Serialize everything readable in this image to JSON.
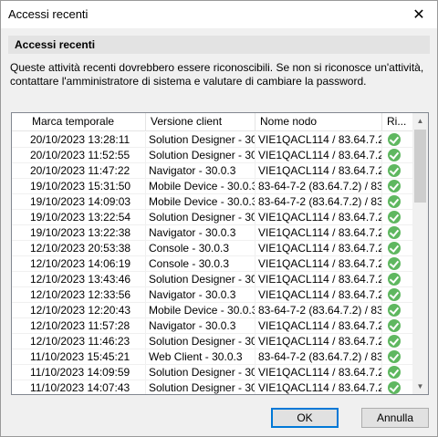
{
  "window": {
    "title": "Accessi recenti",
    "close_glyph": "✕"
  },
  "section": {
    "title": "Accessi recenti"
  },
  "description": "Queste attività recenti dovrebbero essere riconoscibili. Se non si riconosce un'attività, contattare l'amministratore di sistema e valutare di cambiare la password.",
  "grid": {
    "columns": [
      "Marca temporale",
      "Versione client",
      "Nome nodo",
      "Ri..."
    ],
    "rows": [
      [
        "20/10/2023 13:28:11",
        "Solution Designer - 30...",
        "VIE1QACL114 / 83.64.7.2"
      ],
      [
        "20/10/2023 11:52:55",
        "Solution Designer - 30...",
        "VIE1QACL114 / 83.64.7.2"
      ],
      [
        "20/10/2023 11:47:22",
        "Navigator - 30.0.3",
        "VIE1QACL114 / 83.64.7.2"
      ],
      [
        "19/10/2023 15:31:50",
        "Mobile Device - 30.0.3",
        "83-64-7-2 (83.64.7.2) / 83..."
      ],
      [
        "19/10/2023 14:09:03",
        "Mobile Device - 30.0.3",
        "83-64-7-2 (83.64.7.2) / 83..."
      ],
      [
        "19/10/2023 13:22:54",
        "Solution Designer - 30...",
        "VIE1QACL114 / 83.64.7.2"
      ],
      [
        "19/10/2023 13:22:38",
        "Navigator - 30.0.3",
        "VIE1QACL114 / 83.64.7.2"
      ],
      [
        "12/10/2023 20:53:38",
        "Console - 30.0.3",
        "VIE1QACL114 / 83.64.7.2"
      ],
      [
        "12/10/2023 14:06:19",
        "Console - 30.0.3",
        "VIE1QACL114 / 83.64.7.2"
      ],
      [
        "12/10/2023 13:43:46",
        "Solution Designer - 30...",
        "VIE1QACL114 / 83.64.7.2"
      ],
      [
        "12/10/2023 12:33:56",
        "Navigator - 30.0.3",
        "VIE1QACL114 / 83.64.7.2"
      ],
      [
        "12/10/2023 12:20:43",
        "Mobile Device - 30.0.3",
        "83-64-7-2 (83.64.7.2) / 83..."
      ],
      [
        "12/10/2023 11:57:28",
        "Navigator - 30.0.3",
        "VIE1QACL114 / 83.64.7.2"
      ],
      [
        "12/10/2023 11:46:23",
        "Solution Designer - 30...",
        "VIE1QACL114 / 83.64.7.2"
      ],
      [
        "11/10/2023 15:45:21",
        "Web Client - 30.0.3",
        "83-64-7-2 (83.64.7.2) / 83..."
      ],
      [
        "11/10/2023 14:09:59",
        "Solution Designer - 30...",
        "VIE1QACL114 / 83.64.7.2"
      ],
      [
        "11/10/2023 14:07:43",
        "Solution Designer - 30...",
        "VIE1QACL114 / 83.64.7.2"
      ]
    ],
    "status_icon": "check-circle-icon",
    "status_color": "#5fb760"
  },
  "buttons": {
    "ok": "OK",
    "cancel": "Annulla"
  }
}
